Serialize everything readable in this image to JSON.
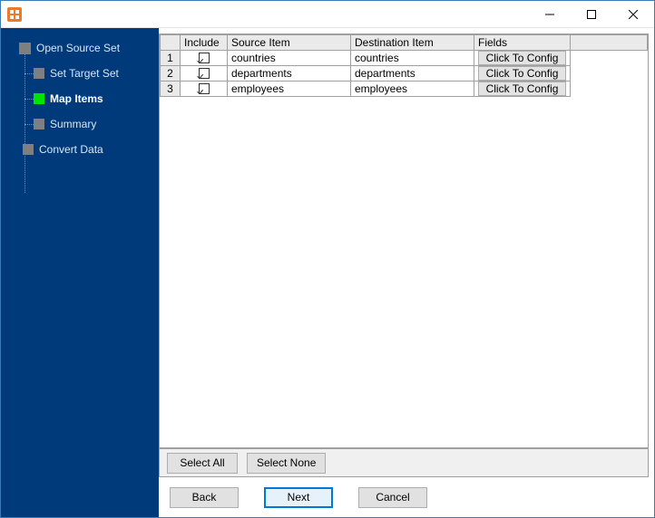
{
  "window": {
    "title": ""
  },
  "sidebar": {
    "items": [
      {
        "label": "Open Source Set",
        "level": "top",
        "active": false
      },
      {
        "label": "Set Target Set",
        "level": "sub",
        "active": false
      },
      {
        "label": "Map Items",
        "level": "sub",
        "active": true
      },
      {
        "label": "Summary",
        "level": "sub",
        "active": false
      },
      {
        "label": "Convert Data",
        "level": "top2",
        "active": false
      }
    ]
  },
  "grid": {
    "headers": {
      "include": "Include",
      "source": "Source Item",
      "destination": "Destination Item",
      "fields": "Fields"
    },
    "rows": [
      {
        "n": "1",
        "include": true,
        "source": "countries",
        "destination": "countries",
        "fields_btn": "Click To Config"
      },
      {
        "n": "2",
        "include": true,
        "source": "departments",
        "destination": "departments",
        "fields_btn": "Click To Config"
      },
      {
        "n": "3",
        "include": true,
        "source": "employees",
        "destination": "employees",
        "fields_btn": "Click To Config"
      }
    ]
  },
  "buttons": {
    "select_all": "Select All",
    "select_none": "Select None",
    "back": "Back",
    "next": "Next",
    "cancel": "Cancel"
  }
}
